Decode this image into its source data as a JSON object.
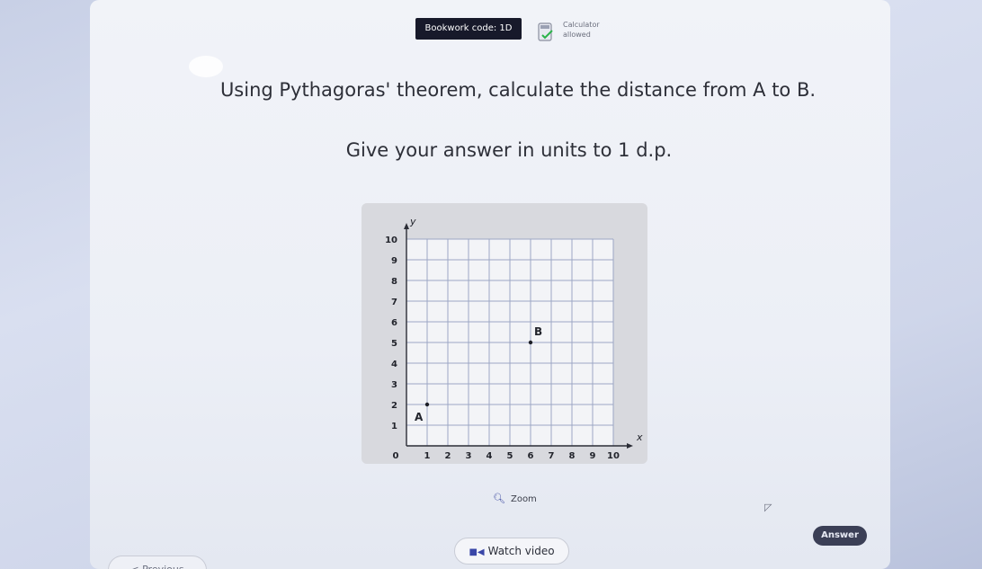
{
  "header": {
    "bookwork_label": "Bookwork code: 1D",
    "calculator_line1": "Calculator",
    "calculator_line2": "allowed",
    "calculator_icon": "calculator-check-icon"
  },
  "question": {
    "line1": "Using Pythagoras' theorem, calculate the distance from A to B.",
    "line2": "Give your answer in units to 1 d.p."
  },
  "graph": {
    "x_axis_label": "x",
    "y_axis_label": "y",
    "origin_label": "0",
    "x_ticks": [
      "1",
      "2",
      "3",
      "4",
      "5",
      "6",
      "7",
      "8",
      "9",
      "10"
    ],
    "y_ticks": [
      "1",
      "2",
      "3",
      "4",
      "5",
      "6",
      "7",
      "8",
      "9",
      "10"
    ],
    "x_range": [
      0,
      10
    ],
    "y_range": [
      0,
      10
    ],
    "grid": true,
    "points": [
      {
        "label": "A",
        "x": 1,
        "y": 2
      },
      {
        "label": "B",
        "x": 6,
        "y": 5
      }
    ]
  },
  "controls": {
    "zoom_label": "Zoom",
    "zoom_icon": "magnifier-icon",
    "watch_video_label": "Watch video",
    "video_icon": "video-icon",
    "answer_label": "Answer",
    "previous_label": "< Previous"
  }
}
